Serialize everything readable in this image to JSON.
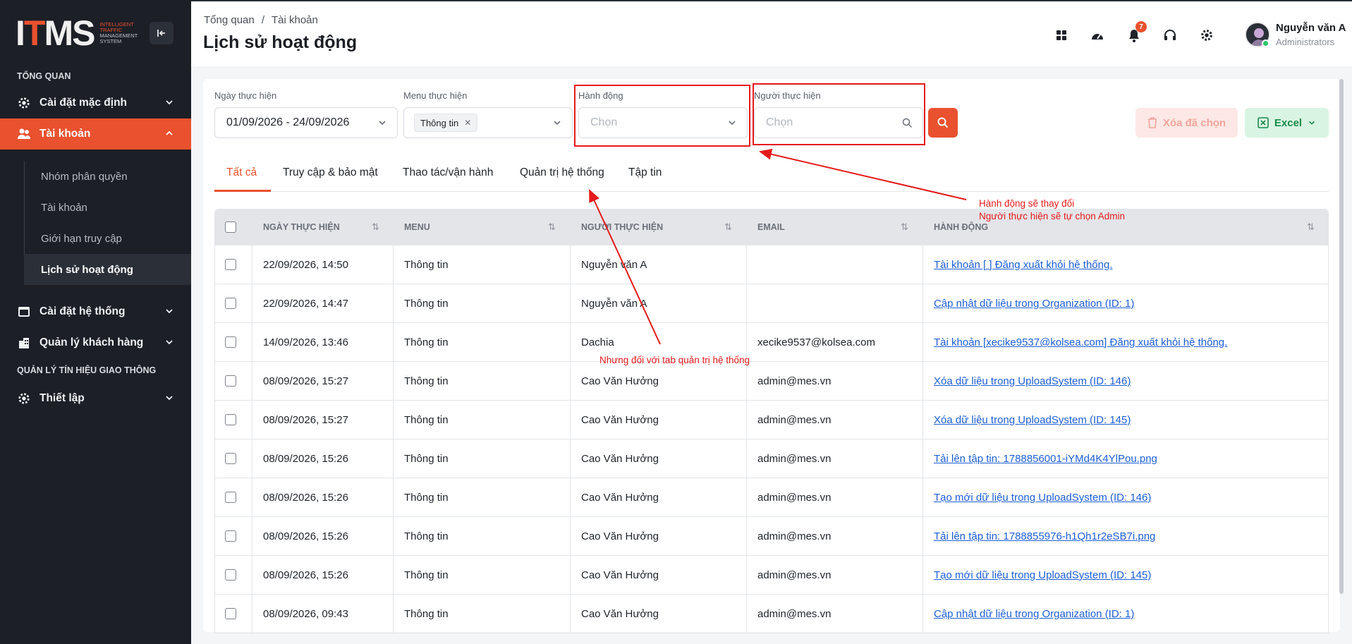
{
  "logo": {
    "mark": "ITMS",
    "tagline": [
      "Intelligent",
      "Traffic",
      "Management",
      "System"
    ]
  },
  "sidebar": {
    "section_overview": "Tổng quan",
    "items": [
      {
        "label": "Cài đặt mặc định",
        "icon": "gear-icon",
        "expanded": false
      },
      {
        "label": "Tài khoản",
        "icon": "users-icon",
        "expanded": true,
        "active": true
      },
      {
        "label": "Cài đặt hệ thống",
        "icon": "window-icon",
        "expanded": false
      },
      {
        "label": "Quản lý khách hàng",
        "icon": "building-icon",
        "expanded": false
      }
    ],
    "sub_items": [
      "Nhóm phân quyền",
      "Tài khoản",
      "Giới hạn truy cập",
      "Lịch sử hoạt động"
    ],
    "current_sub_item": "Lịch sử hoạt động",
    "section_traffic": "Quản lý tín hiệu giao thông",
    "setup_item": "Thiết lập",
    "accent_color": "#e9512f"
  },
  "header": {
    "breadcrumb": [
      "Tổng quan",
      "Tài khoản"
    ],
    "breadcrumb_sep": "/",
    "title": "Lịch sử hoạt động",
    "notification_count": "7",
    "user_name": "Nguyễn văn A",
    "user_role": "Administrators"
  },
  "filters": {
    "date_label": "Ngày thực hiện",
    "date_value": "01/09/2026 - 24/09/2026",
    "menu_label": "Menu thực hiện",
    "menu_chip": "Thông tin",
    "action_label": "Hành động",
    "action_placeholder": "Chọn",
    "actor_label": "Người thực hiện",
    "actor_placeholder": "Chọn",
    "delete_label": "Xóa đã chọn",
    "excel_label": "Excel"
  },
  "tabs": [
    "Tất cả",
    "Truy cập & bảo mật",
    "Thao tác/vận hành",
    "Quản trị hệ thống",
    "Tập tin"
  ],
  "table": {
    "columns": [
      "Ngày thực hiện",
      "Menu",
      "Người thực hiện",
      "Email",
      "Hành động"
    ],
    "rows": [
      {
        "date": "22/09/2026, 14:50",
        "menu": "Thông tin",
        "actor": "Nguyễn văn A",
        "email": "",
        "action": "Tài khoản [ ] Đăng xuất khỏi hệ thống."
      },
      {
        "date": "22/09/2026, 14:47",
        "menu": "Thông tin",
        "actor": "Nguyễn văn A",
        "email": "",
        "action": "Cập nhật dữ liệu trong Organization (ID: 1)"
      },
      {
        "date": "14/09/2026, 13:46",
        "menu": "Thông tin",
        "actor": "Dachia",
        "email": "xecike9537@kolsea.com",
        "action": "Tài khoản [xecike9537@kolsea.com] Đăng xuất khỏi hệ thống."
      },
      {
        "date": "08/09/2026, 15:27",
        "menu": "Thông tin",
        "actor": "Cao Văn Hưởng",
        "email": "admin@mes.vn",
        "action": "Xóa dữ liệu trong UploadSystem (ID: 146)"
      },
      {
        "date": "08/09/2026, 15:27",
        "menu": "Thông tin",
        "actor": "Cao Văn Hưởng",
        "email": "admin@mes.vn",
        "action": "Xóa dữ liệu trong UploadSystem (ID: 145)"
      },
      {
        "date": "08/09/2026, 15:26",
        "menu": "Thông tin",
        "actor": "Cao Văn Hưởng",
        "email": "admin@mes.vn",
        "action": "Tải lên tập tin: 1788856001-iYMd4K4YlPou.png"
      },
      {
        "date": "08/09/2026, 15:26",
        "menu": "Thông tin",
        "actor": "Cao Văn Hưởng",
        "email": "admin@mes.vn",
        "action": "Tạo mới dữ liệu trong UploadSystem (ID: 146)"
      },
      {
        "date": "08/09/2026, 15:26",
        "menu": "Thông tin",
        "actor": "Cao Văn Hưởng",
        "email": "admin@mes.vn",
        "action": "Tải lên tập tin: 1788855976-h1Qh1r2eSB7i.png"
      },
      {
        "date": "08/09/2026, 15:26",
        "menu": "Thông tin",
        "actor": "Cao Văn Hưởng",
        "email": "admin@mes.vn",
        "action": "Tạo mới dữ liệu trong UploadSystem (ID: 145)"
      },
      {
        "date": "08/09/2026, 09:43",
        "menu": "Thông tin",
        "actor": "Cao Văn Hưởng",
        "email": "admin@mes.vn",
        "action": "Cập nhật dữ liệu trong Organization (ID: 1)"
      }
    ]
  },
  "annotations": {
    "note_1": "Hành động sẽ thay đổi",
    "note_2": "Người thực hiện sẽ tự chọn Admin",
    "note_3": "Nhưng đối với tab quản trị hệ thống",
    "color": "#e41b1b"
  }
}
